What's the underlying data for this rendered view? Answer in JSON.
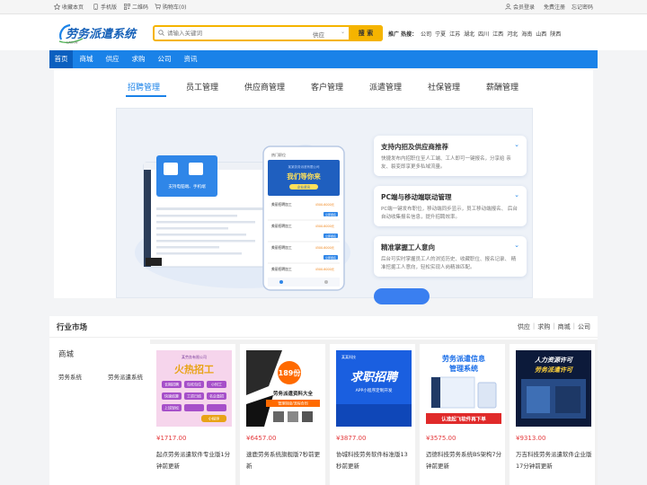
{
  "topbar": {
    "left": [
      {
        "label": "收藏本页",
        "icon": "star-icon"
      },
      {
        "label": "手机版",
        "icon": "phone-icon"
      },
      {
        "label": "二维码",
        "icon": "qrcode-icon"
      },
      {
        "label": "购物车(0)",
        "icon": "cart-icon"
      }
    ],
    "right": [
      {
        "label": "会员登录",
        "icon": "user-icon"
      },
      {
        "label": "免费注册"
      },
      {
        "label": "忘记密码"
      }
    ]
  },
  "logo": {
    "text": "劳务派遣系统"
  },
  "search": {
    "placeholder": "请输入关键词",
    "category": "供应",
    "button": "搜 索"
  },
  "hot": {
    "label": "推广 热搜：",
    "items": [
      "公司",
      "宁夏",
      "江苏",
      "湖北",
      "四川",
      "江西",
      "河北",
      "海南",
      "山西",
      "陕西"
    ]
  },
  "nav": {
    "items": [
      "首页",
      "商城",
      "供应",
      "求购",
      "公司",
      "资讯"
    ],
    "active": 0
  },
  "feature": {
    "tabs": [
      "招聘管理",
      "员工管理",
      "供应商管理",
      "客户管理",
      "派遣管理",
      "社保管理",
      "薪酬管理"
    ],
    "active_tab": 0,
    "panels": [
      {
        "title": "支持内招及供应商推荐",
        "desc": "快捷发布内招职位至人工端、工人即可一键报名，分享给 亲友、裂变即享更多私域流量。"
      },
      {
        "title": "PC端与移动端联动管理",
        "desc": "PC端一键发布职位，移动端同步显示，员工移动端报名、 后台自动收集报名信息，提升招聘效率。"
      },
      {
        "title": "精准掌握工人意向",
        "desc": "后台可实时掌握员工人的浏览历史、收藏职位、报名记录、 精准挖掘工人意向，轻松实现人岗精准匹配。"
      }
    ],
    "mockup": {
      "desktop_tip": "支持电脑端、手机端",
      "phone_header": "热门职位",
      "phone_banner_small": "某某劳务派遣有限公司",
      "phone_banner_big": "我们等你来",
      "phone_banner_tag": "企业资讯",
      "jobs": [
        {
          "title": "美丽招聘加工",
          "pay": "4500-6000元"
        },
        {
          "title": "美丽招聘加工",
          "pay": "4500-6000元"
        },
        {
          "title": "美丽招聘加工",
          "pay": "4500-6000元"
        },
        {
          "title": "美丽招聘加工",
          "pay": "4500-6000元"
        }
      ],
      "apply": "立即报名"
    }
  },
  "market": {
    "title": "行业市场",
    "links": [
      "供应",
      "求购",
      "商城",
      "公司"
    ],
    "side_title": "商城",
    "side_items": [
      "劳务系统",
      "劳务派遣系统"
    ],
    "products": [
      {
        "price": "¥1717.00",
        "name": "起点劳务派遣软件专业版1分钟前更新",
        "img_texts": [
          "某劳务有限公司",
          "火热招工",
          "长期招聘",
          "包吃包住",
          "小时工",
          "快速结算",
          "工资日结",
          "名企直招",
          "上班轻松",
          "小程序"
        ]
      },
      {
        "price": "¥6457.00",
        "name": "速鹿劳务系统旗舰版7秒前更新",
        "img_texts": [
          "189份",
          "劳务派遣资料大全",
          "管理制度/流程合同"
        ]
      },
      {
        "price": "¥3877.00",
        "name": "协城科技劳务软件标准版13秒前更新",
        "img_texts": [
          "某某科技",
          "求职招聘",
          "APP小程序定制开发"
        ]
      },
      {
        "price": "¥3575.00",
        "name": "迈德科技劳务系统BS架构7分钟前更新",
        "img_texts": [
          "劳务派遣信息",
          "管理系统",
          "认准起飞软件再下单"
        ]
      },
      {
        "price": "¥9313.00",
        "name": "万吉科技劳务派遣软件企业版17分钟前更新",
        "img_texts": [
          "人力资源许可",
          "劳务派遣许可"
        ]
      }
    ]
  },
  "colors": {
    "brand": "#1a82e8",
    "nav_active": "#0b5fbf",
    "accent": "#f5b400",
    "price": "#e4393c"
  }
}
